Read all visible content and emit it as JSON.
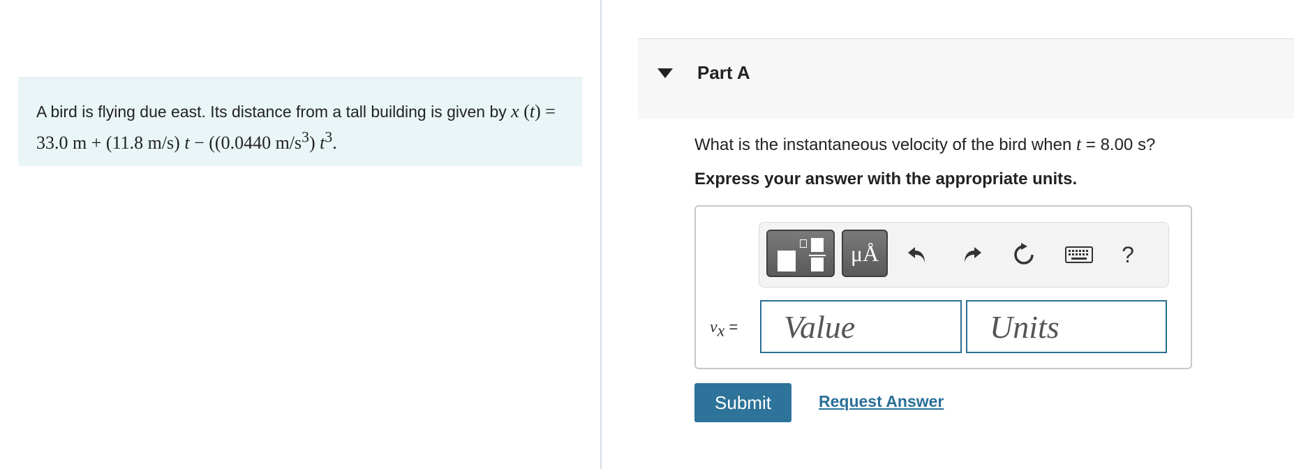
{
  "problem": {
    "text": "A bird is flying due east. Its distance from a tall building is given by ",
    "equation": {
      "lhs_var": "x",
      "lhs_arg": "t",
      "eq": "=",
      "term1": "33.0 m",
      "op1": "+",
      "term2_coef": "(11.8 m/s)",
      "term2_var": "t",
      "op2": "−",
      "term3_coef_open": "(0.0440 m/s",
      "term3_exp": "3",
      "term3_coef_close": ")",
      "term3_var": "t",
      "term3_var_exp": "3",
      "end": "."
    }
  },
  "part": {
    "title": "Part A",
    "question_prefix": "What is the instantaneous velocity of the bird when ",
    "question_var": "t",
    "question_suffix": " = 8.00 s?",
    "instructions": "Express your answer with the appropriate units."
  },
  "toolbar": {
    "units_label": "μÅ",
    "help_label": "?",
    "icons": [
      "templates-icon",
      "units-icon",
      "undo-icon",
      "redo-icon",
      "reset-icon",
      "keyboard-icon",
      "help-icon"
    ]
  },
  "answer": {
    "var_symbol": "v",
    "var_subscript": "x",
    "equals": " =",
    "value_placeholder": "Value",
    "units_placeholder": "Units"
  },
  "actions": {
    "submit_label": "Submit",
    "request_label": "Request Answer"
  },
  "colors": {
    "problem_bg": "#eaf5f7",
    "submit_bg": "#2e7399",
    "link": "#2a6f98",
    "input_border": "#2b6f93"
  }
}
